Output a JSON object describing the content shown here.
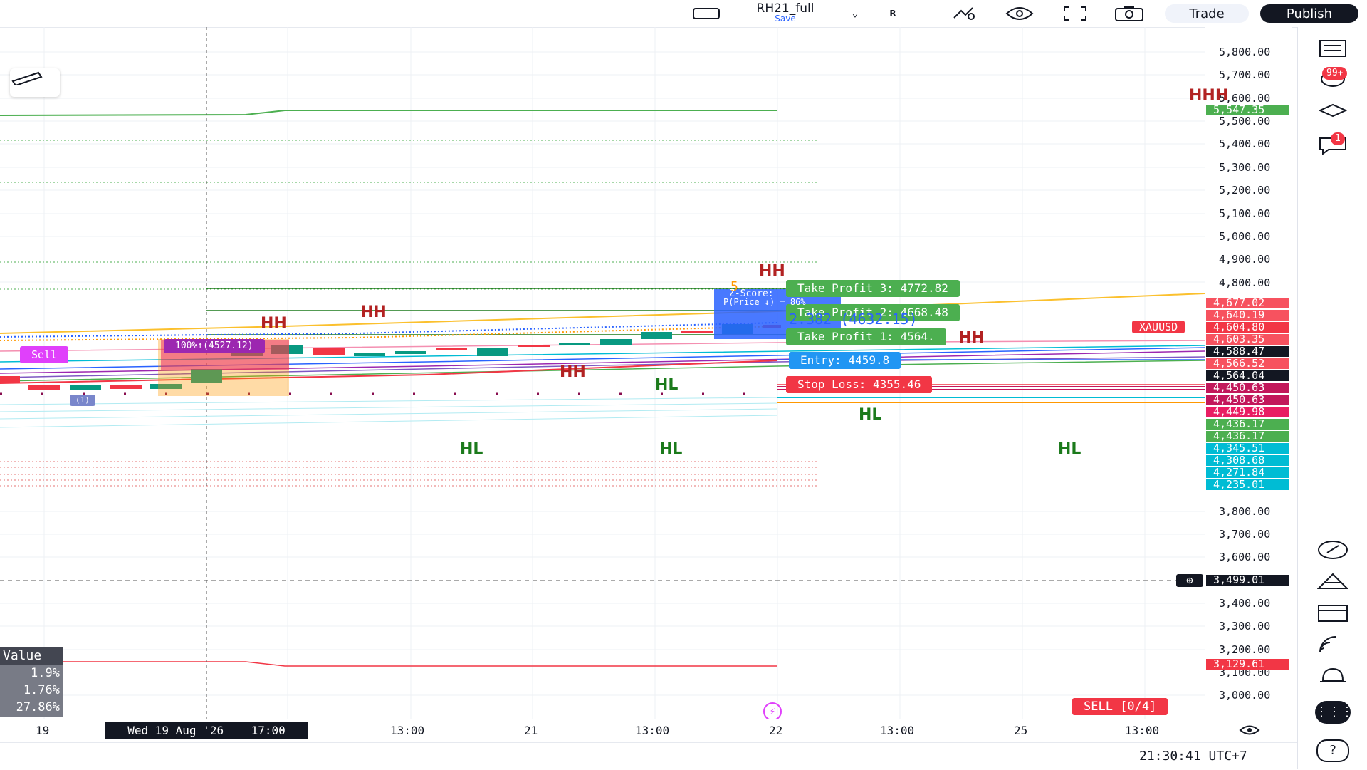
{
  "toolbar": {
    "symbol": "RH21_full",
    "save_label": "Save",
    "r_label": "R",
    "trade_label": "Trade",
    "publish_label": "Publish"
  },
  "price_axis": {
    "ticks": [
      "5,800.00",
      "5,700.00",
      "5,600.00",
      "5,500.00",
      "5,400.00",
      "5,300.00",
      "5,200.00",
      "5,100.00",
      "5,000.00",
      "4,900.00",
      "4,800.00",
      "3,800.00",
      "3,700.00",
      "3,600.00",
      "3,400.00",
      "3,300.00",
      "3,200.00",
      "3,100.00",
      "3,000.00"
    ],
    "badges": [
      {
        "text": "5,547.35",
        "color": "#4caf50"
      },
      {
        "text": "4,677.02",
        "color": "#f7525f"
      },
      {
        "text": "4,640.19",
        "color": "#f7525f"
      },
      {
        "text": "4,604.80",
        "color": "#f23645"
      },
      {
        "text": "4,603.35",
        "color": "#f7525f"
      },
      {
        "text": "4,588.47",
        "color": "#131722"
      },
      {
        "text": "4,566.52",
        "color": "#f7525f"
      },
      {
        "text": "4,564.04",
        "color": "#131722"
      },
      {
        "text": "4,450.63",
        "color": "#c2185b"
      },
      {
        "text": "4,450.63",
        "color": "#c2185b"
      },
      {
        "text": "4,449.98",
        "color": "#e91e63"
      },
      {
        "text": "4,436.17",
        "color": "#4caf50"
      },
      {
        "text": "4,436.17",
        "color": "#4caf50"
      },
      {
        "text": "4,345.51",
        "color": "#00bcd4"
      },
      {
        "text": "4,308.68",
        "color": "#00bcd4"
      },
      {
        "text": "4,271.84",
        "color": "#00bcd4"
      },
      {
        "text": "4,235.01",
        "color": "#00bcd4"
      },
      {
        "text": "3,499.01",
        "color": "#131722"
      },
      {
        "text": "3,129.61",
        "color": "#f23645"
      }
    ],
    "symbol_tag": "XAUUSD",
    "hhh_label": "HHH"
  },
  "trade_levels": {
    "tp3": "Take Profit 3: 4772.82",
    "tp2": "Take Profit 2: 4668.48",
    "tp1": "Take Profit 1: 4564.",
    "entry": "Entry: 4459.8",
    "sl": "Stop Loss: 4355.46"
  },
  "chart_labels": {
    "hh": "HH",
    "hl": "HL",
    "sell_tag": "Sell",
    "pct_tag": "100%↑(4527.12)",
    "zscore": "Z-Score:",
    "pprice": "P(Price ↓) = 86%",
    "num5": "5",
    "small_marker": "(1)",
    "zvalue": "2.382 (4632.15)"
  },
  "stats_table": {
    "header": "Value",
    "rows": [
      "1.9%",
      "1.76%",
      "27.86%"
    ]
  },
  "time_axis": {
    "labels": [
      "19",
      "13:00",
      "21",
      "13:00",
      "22",
      "13:00",
      "25",
      "13:00"
    ],
    "crosshair": "Wed 19 Aug '26    17:00"
  },
  "sell_counter": "SELL  [0/4]",
  "clock": "21:30:41 UTC+7",
  "colors": {
    "green": "#1b7a1b",
    "red": "#b22222",
    "accent": "#2962ff"
  }
}
